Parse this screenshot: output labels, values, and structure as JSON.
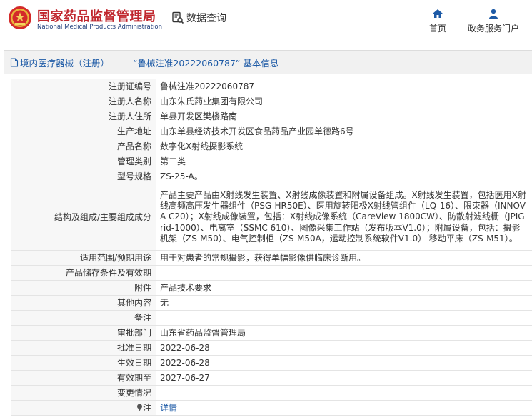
{
  "header": {
    "brand_cn": "国家药品监督管理局",
    "brand_en": "National Medical Products Administration",
    "data_query": "数据查询",
    "nav": [
      {
        "label": "首页",
        "icon": "home-icon"
      },
      {
        "label": "政务服务门户",
        "icon": "user-icon"
      }
    ]
  },
  "colors": {
    "brand_red": "#c0262d",
    "brand_blue": "#1f3d7a",
    "link_blue": "#1d5aa6"
  },
  "title": "境内医疗器械（注册） —— “鲁械注准20222060787” 基本信息",
  "rows": [
    {
      "label": "注册证编号",
      "value": "鲁械注准20222060787"
    },
    {
      "label": "注册人名称",
      "value": "山东朱氏药业集团有限公司"
    },
    {
      "label": "注册人住所",
      "value": "单县开发区樊楼路南"
    },
    {
      "label": "生产地址",
      "value": "山东单县经济技术开发区食品药品产业园单德路6号"
    },
    {
      "label": "产品名称",
      "value": "数字化X射线摄影系统"
    },
    {
      "label": "管理类别",
      "value": "第二类"
    },
    {
      "label": "型号规格",
      "value": "ZS-25-A。"
    },
    {
      "label": "结构及组成/主要组成成分",
      "value": "产品主要产品由X射线发生装置、X射线成像装置和附属设备组成。X射线发生装置，包括医用X射线高频高压发生器组件（PSG-HR50E）、医用旋转阳极X射线管组件（LQ-16）、限束器（INNOVA C20）；X射线成像装置，包括：X射线成像系统（CareView 1800CW）、防散射滤线栅（JPIGrid-1000）、电离室（SSMC 610）、图像采集工作站（发布版本V1.0）；附属设备，包括：摄影机架（ZS-M50）、电气控制柜（ZS-M50A，运动控制系统软件V1.0） 移动平床（ZS-M51）。"
    },
    {
      "label": "适用范围/预期用途",
      "value": "用于对患者的常规摄影，获得单幅影像供临床诊断用。"
    },
    {
      "label": "产品储存条件及有效期",
      "value": ""
    },
    {
      "label": "附件",
      "value": "产品技术要求"
    },
    {
      "label": "其他内容",
      "value": "无"
    },
    {
      "label": "备注",
      "value": ""
    },
    {
      "label": "审批部门",
      "value": "山东省药品监督管理局"
    },
    {
      "label": "批准日期",
      "value": "2022-06-28"
    },
    {
      "label": "生效日期",
      "value": "2022-06-28"
    },
    {
      "label": "有效期至",
      "value": "2027-06-27"
    },
    {
      "label": "变更情况",
      "value": ""
    }
  ],
  "note": {
    "label": "注",
    "icon": "pin-icon",
    "link": "详情"
  }
}
